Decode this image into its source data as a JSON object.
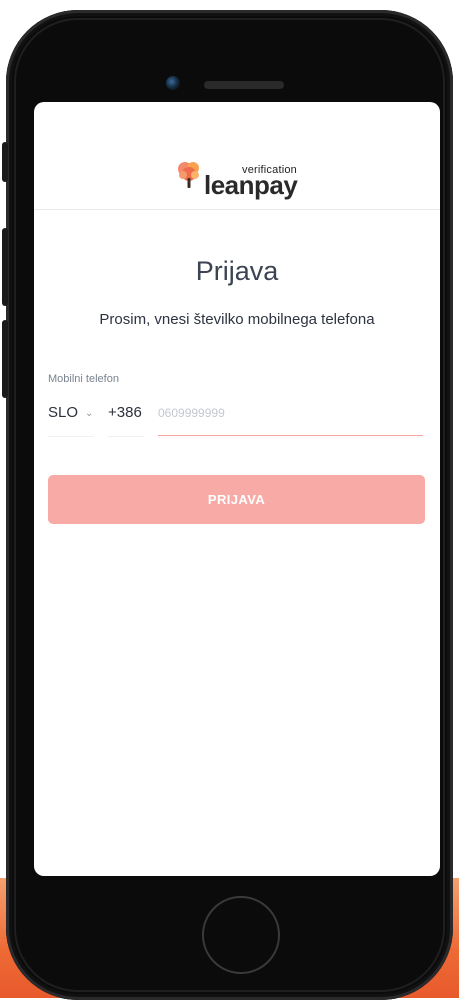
{
  "brand": {
    "tagline": "verification",
    "name": "leanpay"
  },
  "login": {
    "title": "Prijava",
    "subtitle": "Prosim, vnesi številko mobilnega telefona",
    "phone_label": "Mobilni telefon",
    "country": "SLO",
    "dial_code": "+386",
    "phone_placeholder": "0609999999",
    "submit_label": "PRIJAVA"
  },
  "colors": {
    "accent": "#f8aaa6",
    "brand_orange": "#ee6a35"
  }
}
